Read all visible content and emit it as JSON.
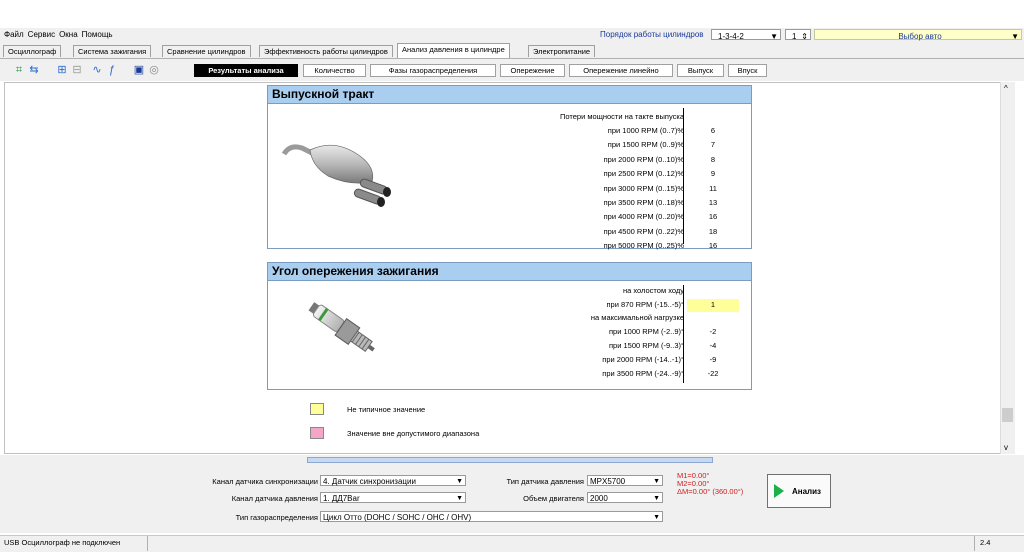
{
  "menu": [
    "Файл",
    "Сервис",
    "Окна",
    "Помощь"
  ],
  "cylinder_order": {
    "label": "Порядок работы цилиндров",
    "value": "1-3-4-2",
    "spin_value": "1"
  },
  "car_select": "Выбор авто",
  "tabs": [
    {
      "label": "Осциллограф",
      "active": false
    },
    {
      "label": "Система зажигания",
      "active": false
    },
    {
      "label": "Сравнение цилиндров",
      "active": false
    },
    {
      "label": "Эффективность работы цилиндров",
      "active": false
    },
    {
      "label": "Анализ давления в цилиндре",
      "active": true
    },
    {
      "label": "Электропитание",
      "active": false
    }
  ],
  "subtabs": [
    {
      "label": "Результаты анализа",
      "active": true
    },
    {
      "label": "Количество",
      "active": false
    },
    {
      "label": "Фазы газораспределения",
      "active": false
    },
    {
      "label": "Опережение",
      "active": false
    },
    {
      "label": "Опережение линейно",
      "active": false
    },
    {
      "label": "Выпуск",
      "active": false
    },
    {
      "label": "Впуск",
      "active": false
    }
  ],
  "exhaust": {
    "title": "Выпускной тракт",
    "header": "Потери мощности на такте выпуска",
    "rows": [
      {
        "label": "при  1000 RPM (0..7)%",
        "value": "6"
      },
      {
        "label": "при  1500 RPM (0..9)%",
        "value": "7"
      },
      {
        "label": "при  2000 RPM (0..10)%",
        "value": "8"
      },
      {
        "label": "при  2500 RPM (0..12)%",
        "value": "9"
      },
      {
        "label": "при  3000 RPM (0..15)%",
        "value": "11"
      },
      {
        "label": "при  3500 RPM (0..18)%",
        "value": "13"
      },
      {
        "label": "при  4000 RPM (0..20)%",
        "value": "16"
      },
      {
        "label": "при  4500 RPM (0..22)%",
        "value": "18"
      },
      {
        "label": "при  5000 RPM (0..25)%",
        "value": "16"
      }
    ]
  },
  "ignition": {
    "title": "Угол опережения зажигания",
    "idle_header": "на холостом ходу",
    "idle_row": {
      "label": "при 870 RPM (-15..-5)°",
      "value": "1"
    },
    "load_header": "на максимальной нагрузке",
    "rows": [
      {
        "label": "при 1000 RPM (-2..9)°",
        "value": "-2"
      },
      {
        "label": "при 1500 RPM (-9..3)°",
        "value": "-4"
      },
      {
        "label": "при 2000 RPM (-14..-1)°",
        "value": "-9"
      },
      {
        "label": "при 3500 RPM (-24..-9)°",
        "value": "-22"
      }
    ]
  },
  "legend": {
    "atypical": "Не типичное значение",
    "out_of_range": "Значение вне допустимого диапазона",
    "atypical_color": "#ffff99",
    "out_of_range_color": "#f4a6c8"
  },
  "settings": {
    "sync_channel_label": "Канал датчика синхронизации",
    "sync_channel_value": "4. Датчик синхронизации",
    "pressure_channel_label": "Канал датчика давления",
    "pressure_channel_value": "1. ДД7Bar",
    "timing_type_label": "Тип газораспределения",
    "timing_type_value": "Цикл Отто (DOHC / SOHC / OHC / OHV)",
    "pressure_sensor_label": "Тип датчика давления",
    "pressure_sensor_value": "MPX5700",
    "engine_volume_label": "Объем двигателя",
    "engine_volume_value": "2000",
    "markers": [
      "M1=0.00°",
      "M2=0.00°",
      "ΔM=0.00° (360.00°)"
    ],
    "analyze_label": "Анализ"
  },
  "status": {
    "left": "USB Осциллограф не подключен",
    "right": "2.4"
  }
}
